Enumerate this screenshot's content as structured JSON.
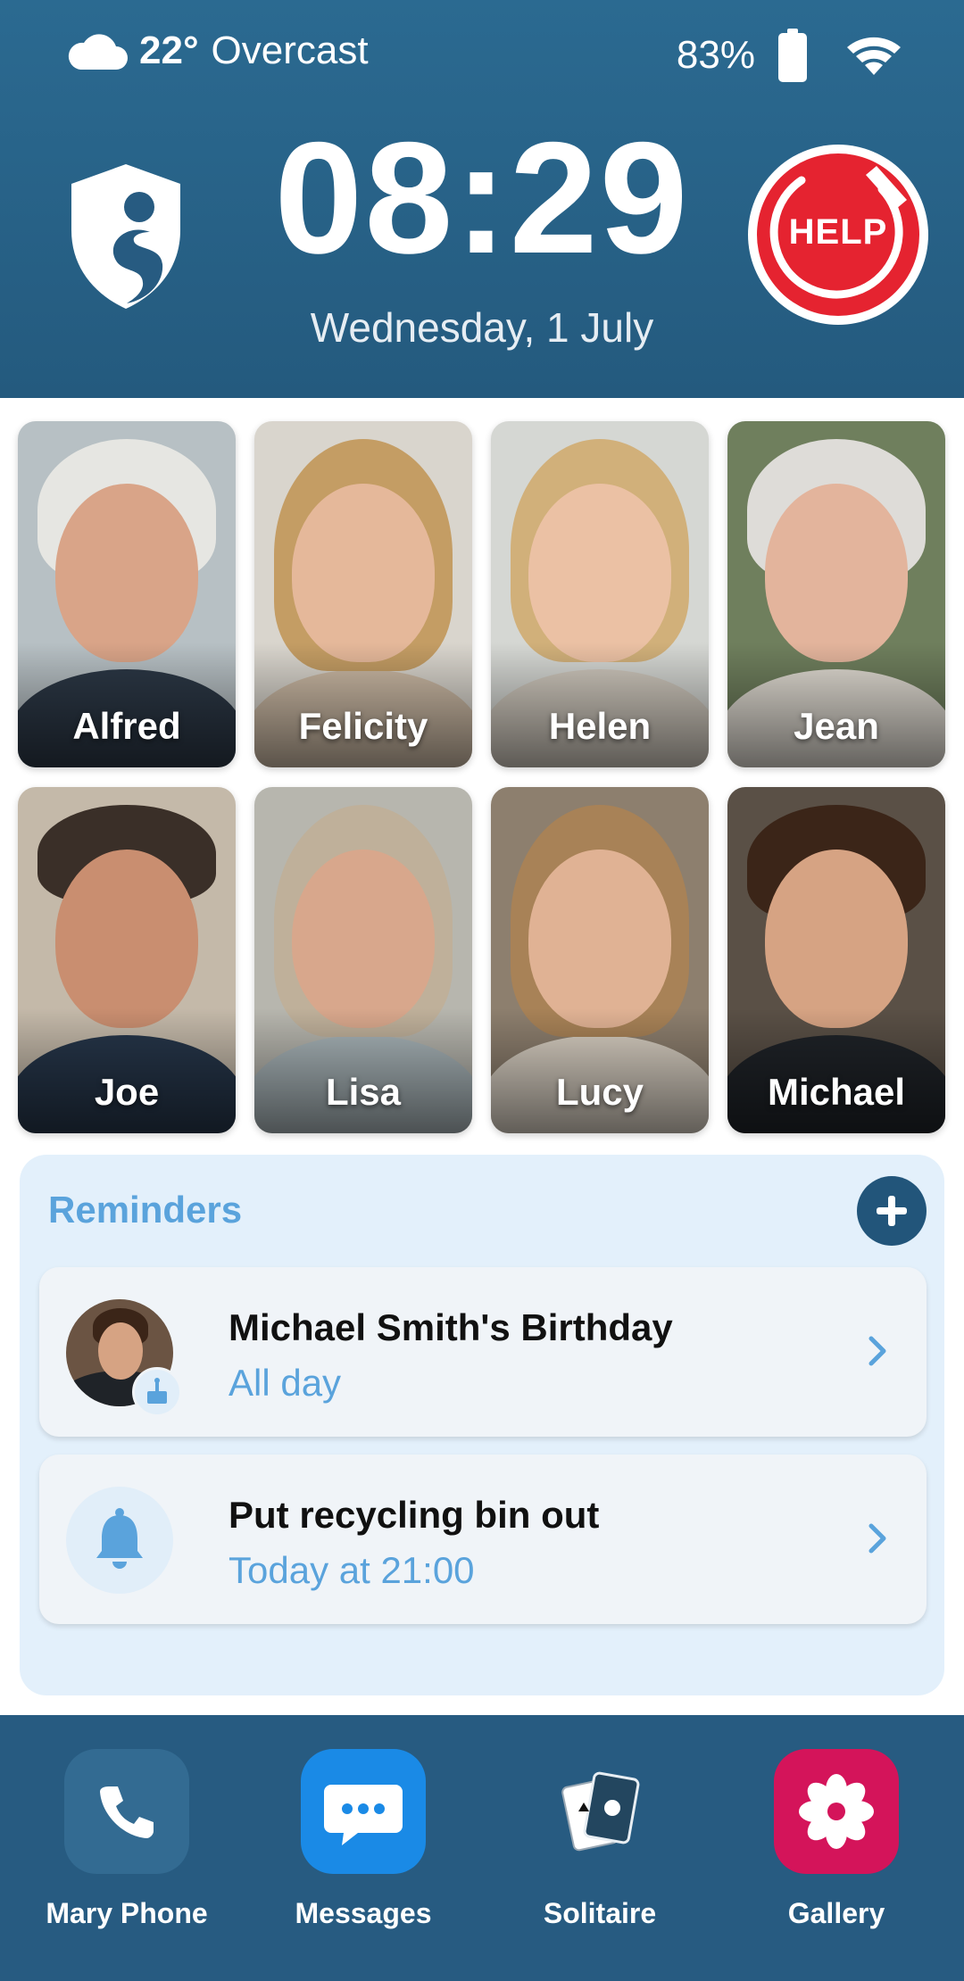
{
  "status_bar": {
    "temperature": "22°",
    "condition": "Overcast",
    "battery": "83%"
  },
  "header": {
    "time": "08:29",
    "date": "Wednesday, 1 July",
    "help_label": "HELP"
  },
  "contacts": [
    {
      "name": "Alfred"
    },
    {
      "name": "Felicity"
    },
    {
      "name": "Helen"
    },
    {
      "name": "Jean"
    },
    {
      "name": "Joe"
    },
    {
      "name": "Lisa"
    },
    {
      "name": "Lucy"
    },
    {
      "name": "Michael"
    }
  ],
  "reminders": {
    "title": "Reminders",
    "items": [
      {
        "title": "Michael Smith's Birthday",
        "subtitle": "All day",
        "icon": "birthday-cake-icon"
      },
      {
        "title": "Put recycling bin out",
        "subtitle": "Today at 21:00",
        "icon": "bell-icon"
      }
    ]
  },
  "dock": [
    {
      "label": "Mary Phone",
      "icon": "phone-icon"
    },
    {
      "label": "Messages",
      "icon": "chat-icon"
    },
    {
      "label": "Solitaire",
      "icon": "cards-icon"
    },
    {
      "label": "Gallery",
      "icon": "flower-icon"
    }
  ],
  "colors": {
    "header_bg": "#2b6a91",
    "help_red": "#e52330",
    "accent_blue": "#5aa3dc",
    "dock_bg": "#275b81",
    "messages_blue": "#1a8ae6",
    "gallery_pink": "#d4145a"
  }
}
